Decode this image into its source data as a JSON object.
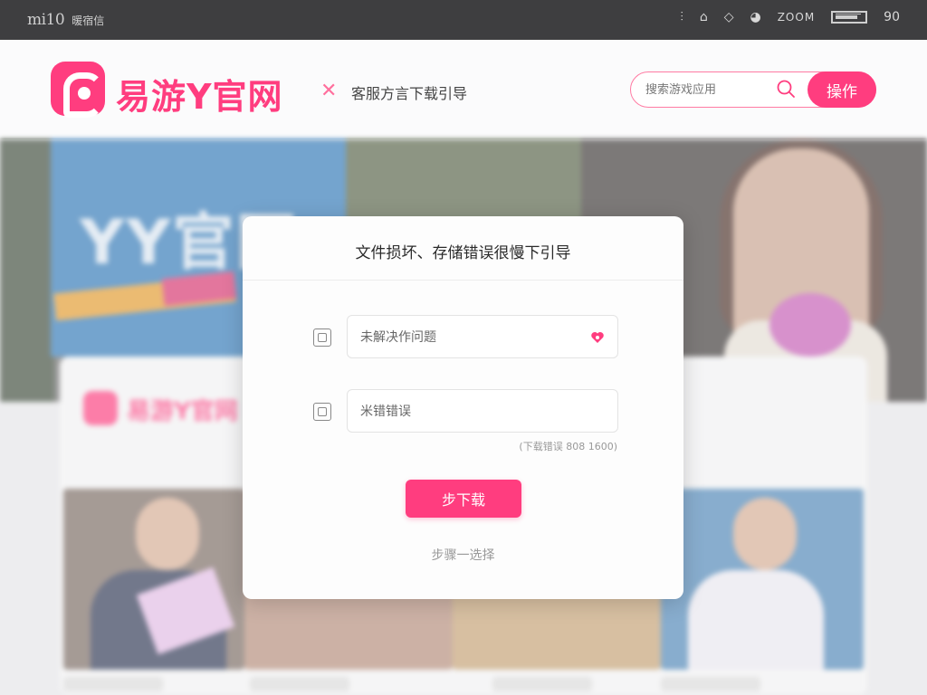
{
  "statusbar": {
    "left_label": "mi10",
    "left_sub": "暖宿信",
    "right_text": "ZOOM",
    "right_num": "90"
  },
  "header": {
    "site_name": "易游Y官网",
    "tagline": "客服方言下载引导",
    "search": {
      "placeholder": "搜索游戏应用",
      "button_label": "操作"
    }
  },
  "background": {
    "hero_board_text": "YY官网",
    "card_title": "易游Y官网"
  },
  "modal": {
    "title": "文件损坏、存储错误很慢下引导",
    "field1_placeholder": "未解决作问题",
    "field2_placeholder": "米错错误",
    "hint": "(下载错误 808 1600)",
    "download_button": "步下载",
    "step_link": "步骤一选择"
  },
  "colors": {
    "accent": "#ff3d7f",
    "statusbar": "#3e3e40"
  }
}
